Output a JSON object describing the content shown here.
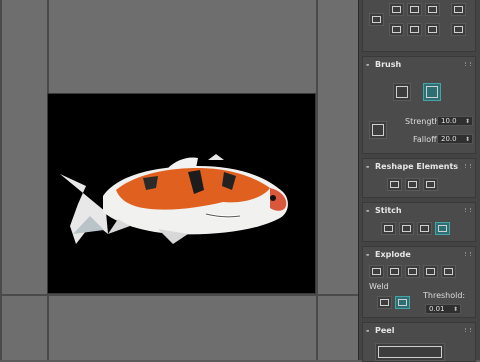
{
  "brush": {
    "title": "Brush",
    "strength_label": "Strength:",
    "strength_value": "10.0",
    "falloff_label": "Falloff:",
    "falloff_value": "20.0"
  },
  "reshape": {
    "title": "Reshape Elements"
  },
  "stitch": {
    "title": "Stitch"
  },
  "explode": {
    "title": "Explode",
    "weld_label": "Weld",
    "threshold_label": "Threshold:",
    "threshold_value": "0.01"
  },
  "peel": {
    "title": "Peel"
  },
  "colors": {
    "teal": "#2e6f73",
    "panel": "#444444"
  }
}
